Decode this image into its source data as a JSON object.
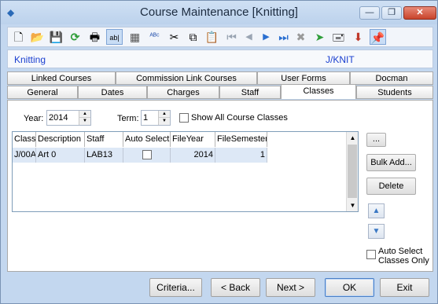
{
  "window": {
    "title": "Course Maintenance  [Knitting]"
  },
  "titlebar_buttons": {
    "minimize": "—",
    "restore": "❐",
    "close": "✕"
  },
  "toolbar": {
    "buttons": [
      {
        "name": "new-icon",
        "glyph": "🗋"
      },
      {
        "name": "open-icon",
        "glyph": "📂"
      },
      {
        "name": "save-icon",
        "glyph": "💾"
      },
      {
        "name": "refresh-icon",
        "glyph": "⟳"
      },
      {
        "name": "print-icon",
        "glyph": "🖶"
      },
      {
        "name": "field-icon",
        "glyph": "ab|"
      },
      {
        "name": "calculator-icon",
        "glyph": "▦"
      },
      {
        "name": "spellcheck-icon",
        "glyph": "ᴬᴮᶜ"
      },
      {
        "name": "cut-icon",
        "glyph": "✂"
      },
      {
        "name": "copy-icon",
        "glyph": "⧉"
      },
      {
        "name": "paste-icon",
        "glyph": "📋"
      },
      {
        "name": "first-record-icon",
        "glyph": "⏮"
      },
      {
        "name": "previous-record-icon",
        "glyph": "◀"
      },
      {
        "name": "next-record-icon",
        "glyph": "▶"
      },
      {
        "name": "last-record-icon",
        "glyph": "⏭"
      },
      {
        "name": "delete-icon",
        "glyph": "✖"
      },
      {
        "name": "goto-icon",
        "glyph": "➤"
      },
      {
        "name": "stamp-icon",
        "glyph": "🖃"
      },
      {
        "name": "download-icon",
        "glyph": "⬇"
      },
      {
        "name": "pin-icon",
        "glyph": "📌"
      }
    ]
  },
  "header": {
    "course_name": "Knitting",
    "course_code": "J/KNIT"
  },
  "tabs_row1": [
    "Linked Courses",
    "Commission Link Courses",
    "User Forms",
    "Docman"
  ],
  "tabs_row2": [
    "General",
    "Dates",
    "Charges",
    "Staff",
    "Classes",
    "Students"
  ],
  "active_tab": "Classes",
  "filters": {
    "year_label": "Year:",
    "year_value": "2014",
    "term_label": "Term:",
    "term_value": "1",
    "show_all_label": "Show All Course Classes",
    "show_all_checked": false
  },
  "grid": {
    "columns": [
      "Class",
      "Description",
      "Staff",
      "Auto Select",
      "FileYear",
      "FileSemester"
    ],
    "rows": [
      {
        "class": "J/00A",
        "description": "Art 0",
        "staff": "LAB13",
        "auto_select": false,
        "file_year": "2014",
        "file_semester": "1"
      }
    ]
  },
  "side_buttons": {
    "ellipsis": "...",
    "bulk_add": "Bulk Add...",
    "delete": "Delete"
  },
  "auto_select_only": {
    "label_line1": "Auto Select",
    "label_line2": "Classes Only",
    "checked": false
  },
  "footer": {
    "criteria": "Criteria...",
    "back": "< Back",
    "next": "Next >",
    "ok": "OK",
    "exit": "Exit"
  }
}
